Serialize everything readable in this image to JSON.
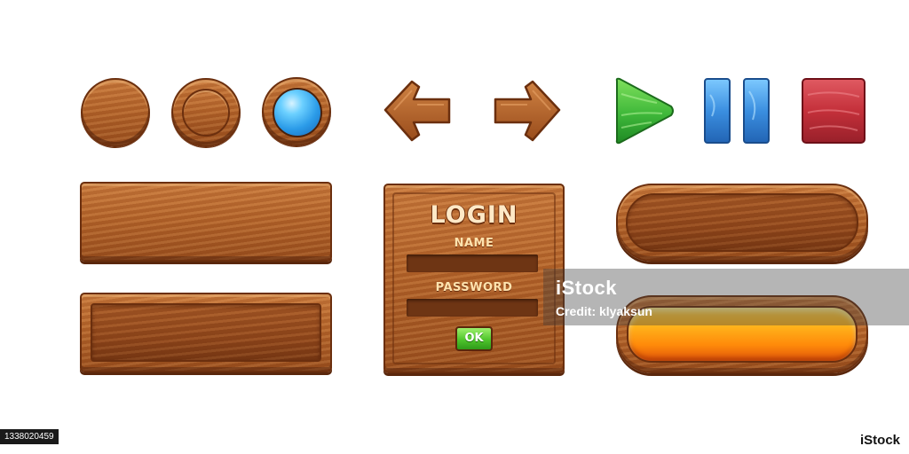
{
  "login_panel": {
    "title": "LOGIN",
    "name_label": "NAME",
    "password_label": "PASSWORD",
    "ok_label": "OK"
  },
  "watermark": {
    "logo_text": "iStock",
    "credit": "Credit: klyaksun"
  },
  "footer": {
    "stock_id": "1338020459",
    "brand": "iStock"
  },
  "icons": {
    "round_buttons": [
      "wood-round-icon",
      "wood-ring-icon",
      "blue-gem-icon"
    ],
    "arrows": [
      "arrow-left-icon",
      "arrow-right-icon"
    ],
    "controls": [
      "play-icon",
      "pause-icon",
      "stop-icon"
    ]
  },
  "colors": {
    "wood": "#b5642a",
    "wood_outline": "#6b2f0e",
    "gem_blue": "#2b9be8",
    "play_green": "#3fb83a",
    "pause_blue": "#3b8fe0",
    "stop_red": "#c4303a",
    "ok_green": "#4fc52c",
    "lava_orange": "#ff9a12"
  }
}
